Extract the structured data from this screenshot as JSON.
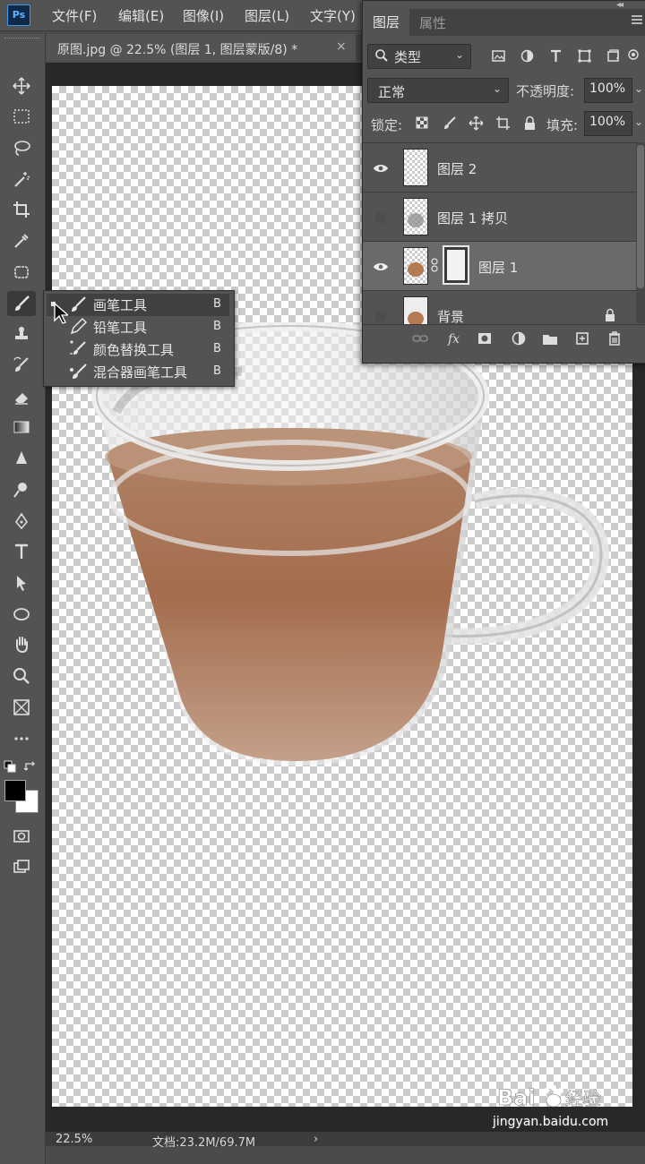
{
  "app": {
    "logo_text": "Ps"
  },
  "menubar": {
    "items": [
      "文件(F)",
      "编辑(E)",
      "图像(I)",
      "图层(L)",
      "文字(Y)"
    ]
  },
  "document_tab": {
    "title": "原图.jpg @ 22.5% (图层 1, 图层蒙版/8) *",
    "close": "×"
  },
  "tool_flyout": {
    "items": [
      {
        "check": "▪",
        "label": "画笔工具",
        "key": "B",
        "icon": "brush-icon"
      },
      {
        "check": "",
        "label": "铅笔工具",
        "key": "B",
        "icon": "pencil-icon"
      },
      {
        "check": "",
        "label": "颜色替换工具",
        "key": "B",
        "icon": "color-replacement-icon"
      },
      {
        "check": "",
        "label": "混合器画笔工具",
        "key": "B",
        "icon": "mixer-brush-icon"
      }
    ]
  },
  "layers_panel": {
    "tabs": [
      "图层",
      "属性"
    ],
    "filter_label": "类型",
    "blend_mode": "正常",
    "opacity_label": "不透明度:",
    "opacity_value": "100%",
    "lock_label": "锁定:",
    "fill_label": "填充:",
    "fill_value": "100%",
    "layers": [
      {
        "name": "图层 2",
        "visible": true,
        "selected": false
      },
      {
        "name": "图层 1 拷贝",
        "visible": false,
        "selected": false
      },
      {
        "name": "图层 1",
        "visible": true,
        "selected": true,
        "has_mask": true
      },
      {
        "name": "背景",
        "visible": false,
        "selected": false,
        "locked": true
      }
    ]
  },
  "status": {
    "zoom": "22.5%",
    "doc_info": "文档:23.2M/69.7M",
    "arrow": "›"
  },
  "watermark": {
    "site": "jingyan.baidu.com",
    "brand": "Baidu 经验"
  },
  "colors": {
    "foreground": "#000000",
    "background": "#ffffff",
    "ui_bg": "#535353",
    "accent": "#3d9be9"
  }
}
